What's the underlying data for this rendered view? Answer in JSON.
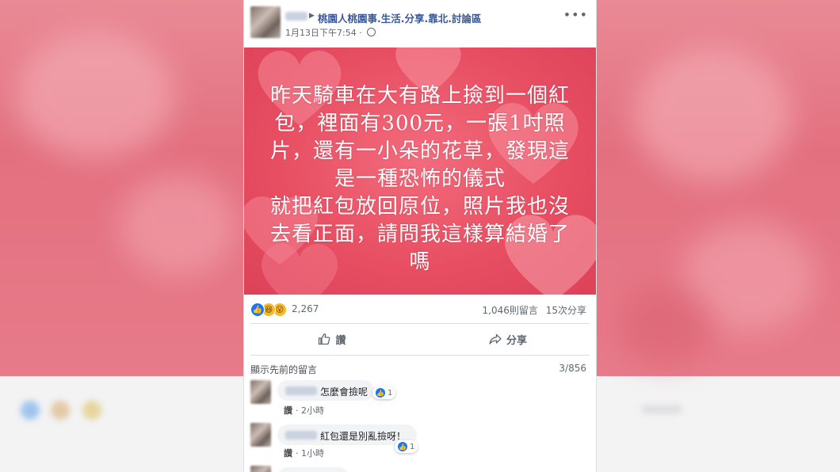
{
  "post": {
    "group_name": "桃園人桃園事.生活.分享.靠北.討論區",
    "timestamp": "1月13日下午7:54",
    "privacy_dot": "·",
    "more_icon": "more-horizontal-icon",
    "image_text": "昨天騎車在大有路上撿到一個紅\n包，裡面有300元，一張1吋照\n片，還有一小朵的花草，發現這\n是一種恐怖的儀式\n就把紅包放回原位，照片我也沒\n去看正面，請問我這樣算結婚了\n嗎",
    "reactions_count": "2,267",
    "comments_count": "1,046則留言",
    "shares_count": "15次分享",
    "like_label": "讚",
    "share_label": "分享"
  },
  "comments_section": {
    "show_previous": "顯示先前的留言",
    "count": "3/856",
    "comments": [
      {
        "text": "怎麼會撿呢",
        "reaction_count": "1",
        "like_label": "讚",
        "time": "2小時"
      },
      {
        "text": "紅包還是別亂撿呀！",
        "reaction_count": "1",
        "like_label": "讚",
        "time": "1小時"
      }
    ]
  },
  "colors": {
    "link_blue": "#385898",
    "facebook_blue": "#1877f2",
    "image_red": "#e84f63"
  }
}
